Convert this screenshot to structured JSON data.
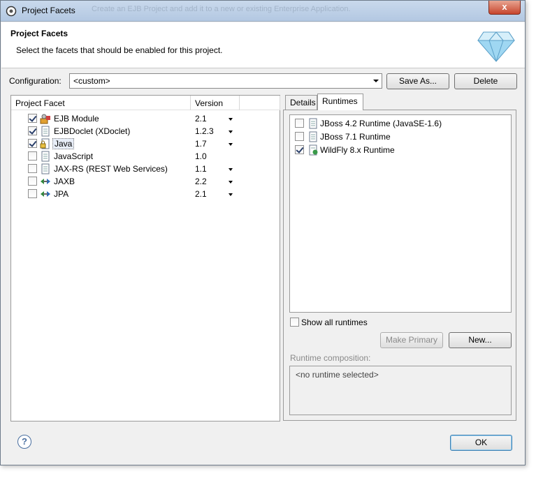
{
  "window": {
    "title": "Project Facets",
    "ghost_text": "Create an EJB Project and add it to a new or existing Enterprise Application.",
    "close_label": "x"
  },
  "header": {
    "title": "Project Facets",
    "description": "Select the facets that should be enabled for this project."
  },
  "configuration": {
    "label": "Configuration:",
    "value": "<custom>",
    "save_as": "Save As...",
    "delete": "Delete"
  },
  "facets": {
    "col_facet": "Project Facet",
    "col_version": "Version",
    "items": [
      {
        "name": "EJB Module",
        "version": "2.1",
        "checked": true,
        "icon": "ejb-module-icon",
        "dropdown": true
      },
      {
        "name": "EJBDoclet (XDoclet)",
        "version": "1.2.3",
        "checked": true,
        "icon": "doc-icon",
        "dropdown": true
      },
      {
        "name": "Java",
        "version": "1.7",
        "checked": true,
        "icon": "java-lock-icon",
        "dropdown": true,
        "selected": true
      },
      {
        "name": "JavaScript",
        "version": "1.0",
        "checked": false,
        "icon": "doc-icon",
        "dropdown": false
      },
      {
        "name": "JAX-RS (REST Web Services)",
        "version": "1.1",
        "checked": false,
        "icon": "doc-icon",
        "dropdown": true
      },
      {
        "name": "JAXB",
        "version": "2.2",
        "checked": false,
        "icon": "arrows-icon",
        "dropdown": true
      },
      {
        "name": "JPA",
        "version": "2.1",
        "checked": false,
        "icon": "arrows-icon",
        "dropdown": true
      }
    ]
  },
  "tabs": {
    "details": "Details",
    "runtimes": "Runtimes"
  },
  "runtimes": {
    "items": [
      {
        "name": "JBoss 4.2 Runtime (JavaSE-1.6)",
        "checked": false
      },
      {
        "name": "JBoss 7.1 Runtime",
        "checked": false
      },
      {
        "name": "WildFly 8.x Runtime",
        "checked": true
      }
    ],
    "show_all": "Show all runtimes",
    "make_primary": "Make Primary",
    "new": "New...",
    "composition_label": "Runtime composition:",
    "composition_value": "<no runtime selected>"
  },
  "footer": {
    "help": "?",
    "ok": "OK"
  }
}
